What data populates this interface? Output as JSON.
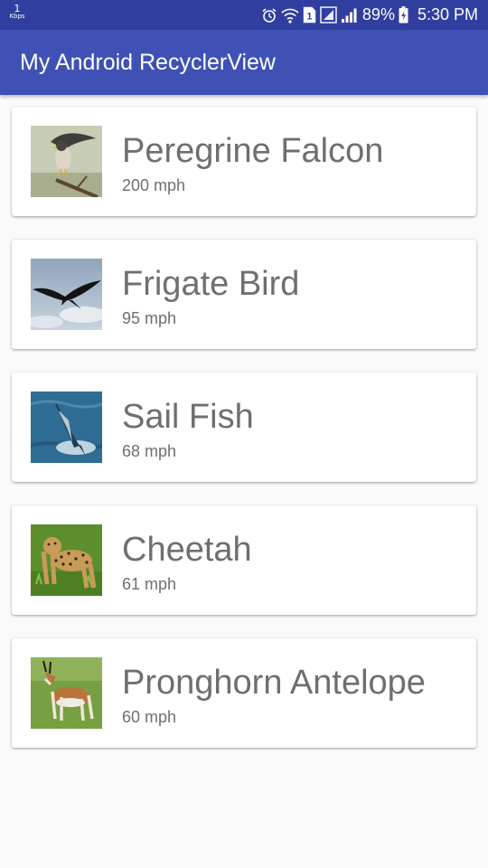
{
  "status_bar": {
    "network_speed_value": "1",
    "network_speed_unit": "Kbps",
    "sim_label": "1",
    "battery_percent": "89%",
    "time": "5:30 PM",
    "icons": [
      "alarm-icon",
      "wifi-icon",
      "sim-icon",
      "signal-icon",
      "battery-icon"
    ]
  },
  "app_bar": {
    "title": "My Android RecyclerView",
    "color": "#3f51b5"
  },
  "list": {
    "items": [
      {
        "name": "Peregrine Falcon",
        "speed": "200 mph",
        "image": "peregrine-falcon-photo"
      },
      {
        "name": "Frigate Bird",
        "speed": "95 mph",
        "image": "frigate-bird-photo"
      },
      {
        "name": "Sail Fish",
        "speed": "68 mph",
        "image": "sail-fish-photo"
      },
      {
        "name": "Cheetah",
        "speed": "61 mph",
        "image": "cheetah-photo"
      },
      {
        "name": "Pronghorn Antelope",
        "speed": "60 mph",
        "image": "pronghorn-antelope-photo"
      }
    ]
  }
}
